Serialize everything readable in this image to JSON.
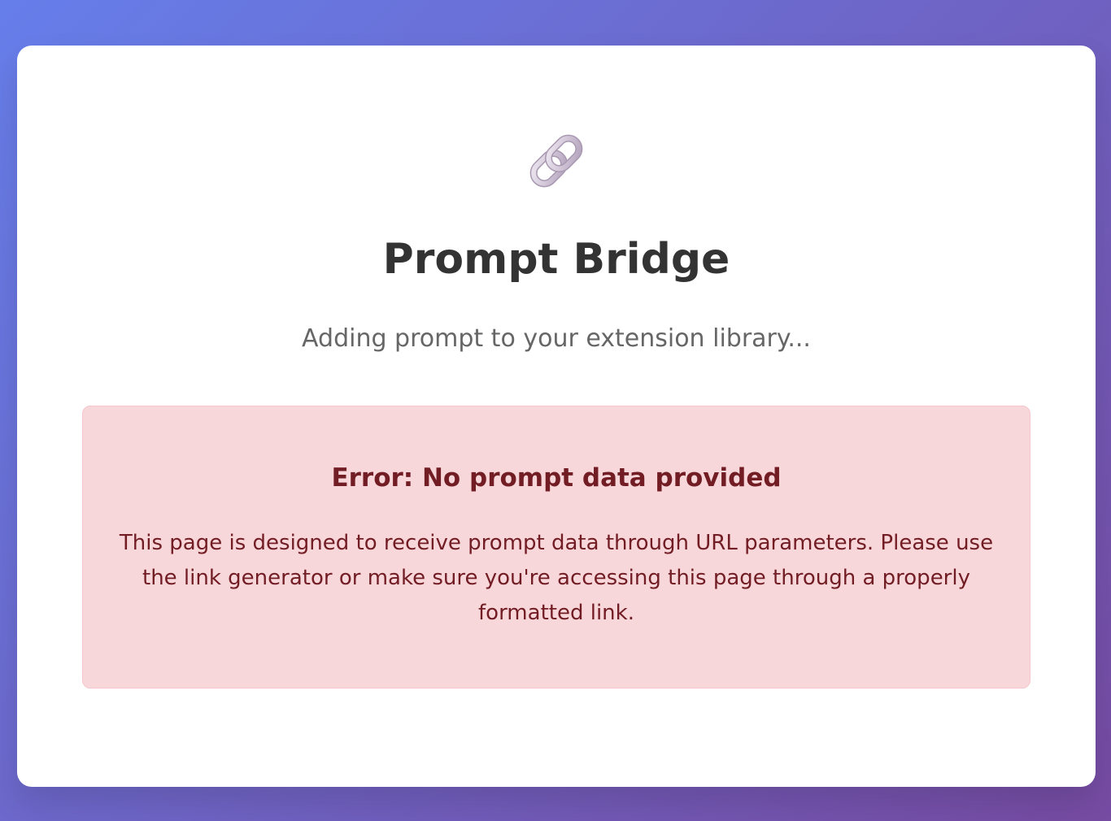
{
  "logo": {
    "icon": "link-icon"
  },
  "header": {
    "title": "Prompt Bridge",
    "subtitle": "Adding prompt to your extension library..."
  },
  "error": {
    "title": "Error: No prompt data provided",
    "message": "This page is designed to receive prompt data through URL parameters. Please use the link generator or make sure you're accessing this page through a properly formatted link."
  },
  "colors": {
    "background_start": "#667eea",
    "background_end": "#764ba2",
    "card": "#ffffff",
    "error_background": "#f8d7da",
    "error_border": "#f5c6cb",
    "error_text": "#721c24"
  }
}
